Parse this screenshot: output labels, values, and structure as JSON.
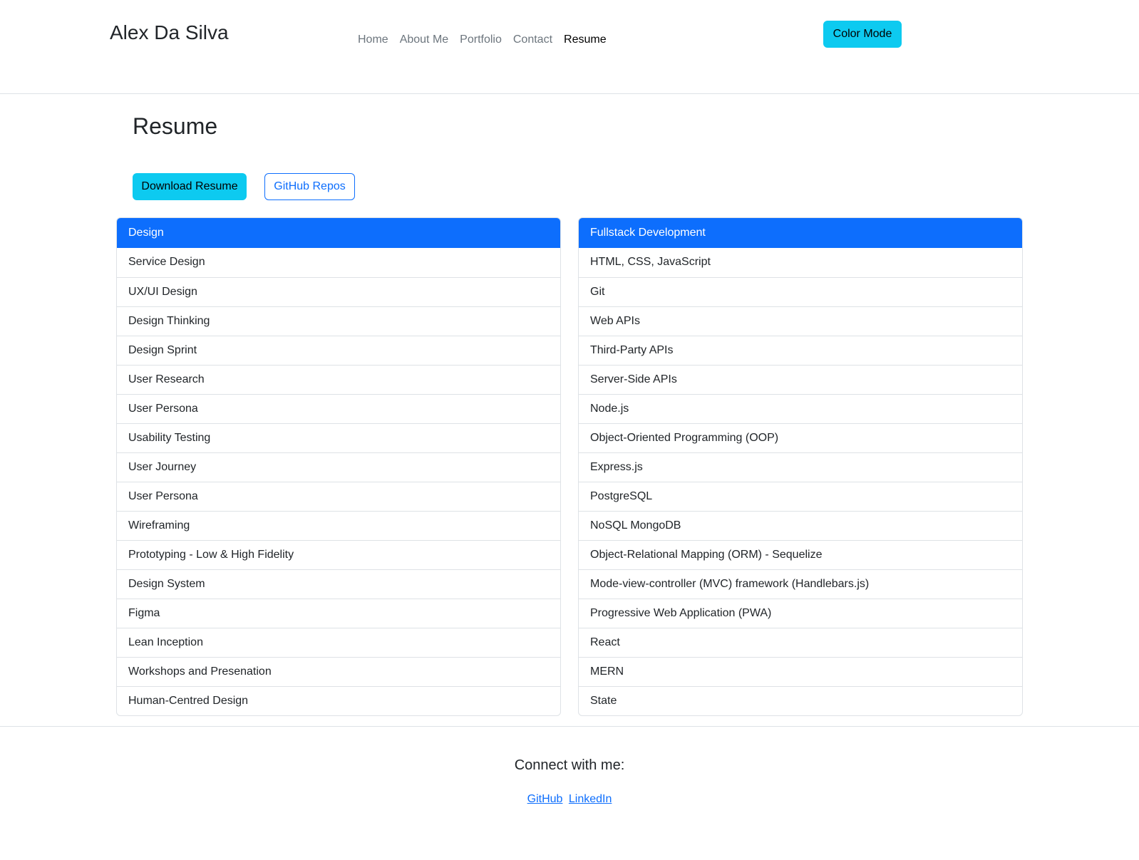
{
  "header": {
    "brand": "Alex Da Silva",
    "nav": [
      {
        "label": "Home"
      },
      {
        "label": "About Me"
      },
      {
        "label": "Portfolio"
      },
      {
        "label": "Contact"
      },
      {
        "label": "Resume",
        "active": true
      }
    ],
    "color_mode_label": "Color Mode"
  },
  "main": {
    "title": "Resume",
    "download_label": "Download Resume",
    "github_repos_label": "GitHub Repos",
    "design": {
      "heading": "Design",
      "items": [
        "Service Design",
        "UX/UI Design",
        "Design Thinking",
        "Design Sprint",
        "User Research",
        "User Persona",
        "Usability Testing",
        "User Journey",
        "User Persona",
        "Wireframing",
        "Prototyping - Low & High Fidelity",
        "Design System",
        "Figma",
        "Lean Inception",
        "Workshops and Presenation",
        "Human-Centred Design"
      ]
    },
    "fullstack": {
      "heading": "Fullstack Development",
      "items": [
        "HTML, CSS, JavaScript",
        "Git",
        "Web APIs",
        "Third-Party APIs",
        "Server-Side APIs",
        "Node.js",
        "Object-Oriented Programming (OOP)",
        "Express.js",
        "PostgreSQL",
        "NoSQL MongoDB",
        "Object-Relational Mapping (ORM) - Sequelize",
        "Mode-view-controller (MVC) framework (Handlebars.js)",
        "Progressive Web Application (PWA)",
        "React",
        "MERN",
        "State"
      ]
    }
  },
  "footer": {
    "title": "Connect with me:",
    "links": [
      {
        "label": "GitHub"
      },
      {
        "label": "LinkedIn"
      }
    ]
  },
  "colors": {
    "accent_cyan": "#0dcaf0",
    "primary_blue": "#0d6efd",
    "text": "#212529",
    "muted": "#6c757d",
    "border": "#dee2e6"
  }
}
